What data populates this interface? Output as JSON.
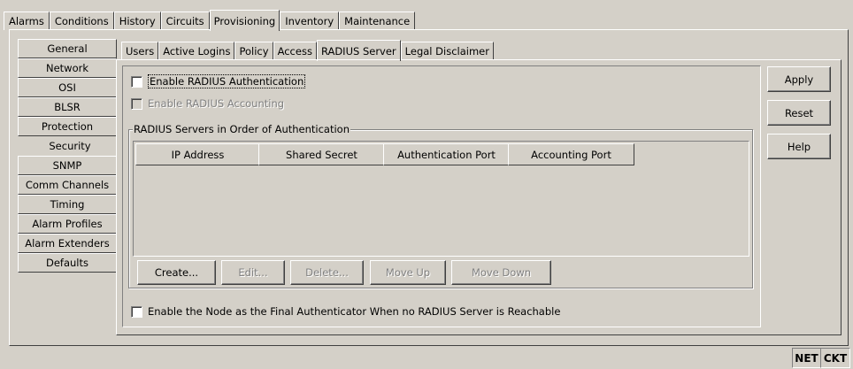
{
  "top_tabs": [
    "Alarms",
    "Conditions",
    "History",
    "Circuits",
    "Provisioning",
    "Inventory",
    "Maintenance"
  ],
  "top_tab_active": "Provisioning",
  "left_nav": [
    "General",
    "Network",
    "OSI",
    "BLSR",
    "Protection",
    "Security",
    "SNMP",
    "Comm Channels",
    "Timing",
    "Alarm Profiles",
    "Alarm Extenders",
    "Defaults"
  ],
  "left_nav_active": "Security",
  "inner_tabs": [
    "Users",
    "Active Logins",
    "Policy",
    "Access",
    "RADIUS Server",
    "Legal Disclaimer"
  ],
  "inner_tab_active": "RADIUS Server",
  "form": {
    "enable_radius_auth": {
      "label": "Enable RADIUS Authentication",
      "checked": false
    },
    "enable_radius_accounting": {
      "label": "Enable RADIUS Accounting",
      "checked": false,
      "disabled": true
    },
    "group_title": "RADIUS Servers in Order of Authentication",
    "columns": [
      "IP Address",
      "Shared Secret",
      "Authentication Port",
      "Accounting Port"
    ],
    "rows": [],
    "buttons": {
      "create": "Create...",
      "edit": "Edit...",
      "delete": "Delete...",
      "move_up": "Move Up",
      "move_down": "Move Down"
    },
    "final_auth": {
      "label": "Enable the Node as the Final Authenticator When no RADIUS Server is Reachable",
      "checked": false
    }
  },
  "side_buttons": {
    "apply": "Apply",
    "reset": "Reset",
    "help": "Help"
  },
  "status": {
    "net": "NET",
    "ckt": "CKT"
  }
}
